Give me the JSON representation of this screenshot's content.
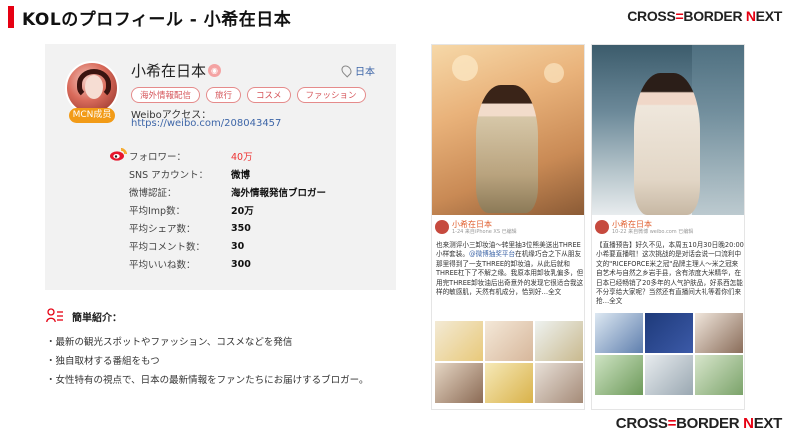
{
  "slide": {
    "title": "KOLのプロフィール - 小希在日本",
    "brand": {
      "left": "CROSS",
      "sep": "=",
      "mid": "BORDER ",
      "accent": "N",
      "end": "EXT"
    },
    "accent_color": "#e60012"
  },
  "profile": {
    "name": "小希在日本",
    "badge": "MCN成员",
    "location": "日本",
    "tags": [
      "海外情報配信",
      "旅行",
      "コスメ",
      "ファッション"
    ],
    "weibo_label": "Weiboアクセス：",
    "weibo_url": "https://weibo.com/208043457",
    "stats": [
      {
        "label": "フォロワー：",
        "value": "40万"
      },
      {
        "label": "SNS アカウント：",
        "value": "微博"
      },
      {
        "label": "微博認証：",
        "value": "海外情報発信ブロガー"
      },
      {
        "label": "平均Imp数：",
        "value": "20万"
      },
      {
        "label": "平均シェア数：",
        "value": "350"
      },
      {
        "label": "平均コメント数：",
        "value": "30"
      },
      {
        "label": "平均いいね数：",
        "value": "300"
      }
    ]
  },
  "intro": {
    "title": "簡単紹介：",
    "items": [
      "・最新の観光スポットやファッション、コスメなどを発信",
      "・独自取材する番組をもつ",
      "・女性特有の視点で、日本の最新情報をファンたちにお届けするブロガー。"
    ]
  },
  "posts": [
    {
      "name": "小希在日本",
      "meta": "1-24 来自iPhone XS 已编辑",
      "text_a": "也来测评小三卸妆油～转里抽3位熊美送出THREE小样套装。",
      "link": "@微博抽奖平台",
      "text_b": "在机缘巧合之下从朋友那里得到了一支THREE的卸妆油，从此后就和THREE杠下了不解之缘。我原本用卸妆乳偏多，但用完THREE卸妆油后出奇意外的发现它很适合我这样的敏感肌，天然有机成分，恰到好…全文"
    },
    {
      "name": "小希在日本",
      "meta": "10-22 来自微博 weibo.com 已编辑",
      "text_a": "【直播预告】好久不见，本周五10月30日晚20:00小希要直播啦！这次挑战的是对话会说一口流利中文的\"RICEFORCE米之冠\"品牌主理人～米之冠来自艺术与自然之乡岩手县，含有浓度大米精华，在日本已经畅销了20多年的人气护肤品，好系西怎能不分享给大家呢？当然还有直播间大礼等着你们来抢…全文",
      "link": "",
      "text_b": ""
    }
  ]
}
